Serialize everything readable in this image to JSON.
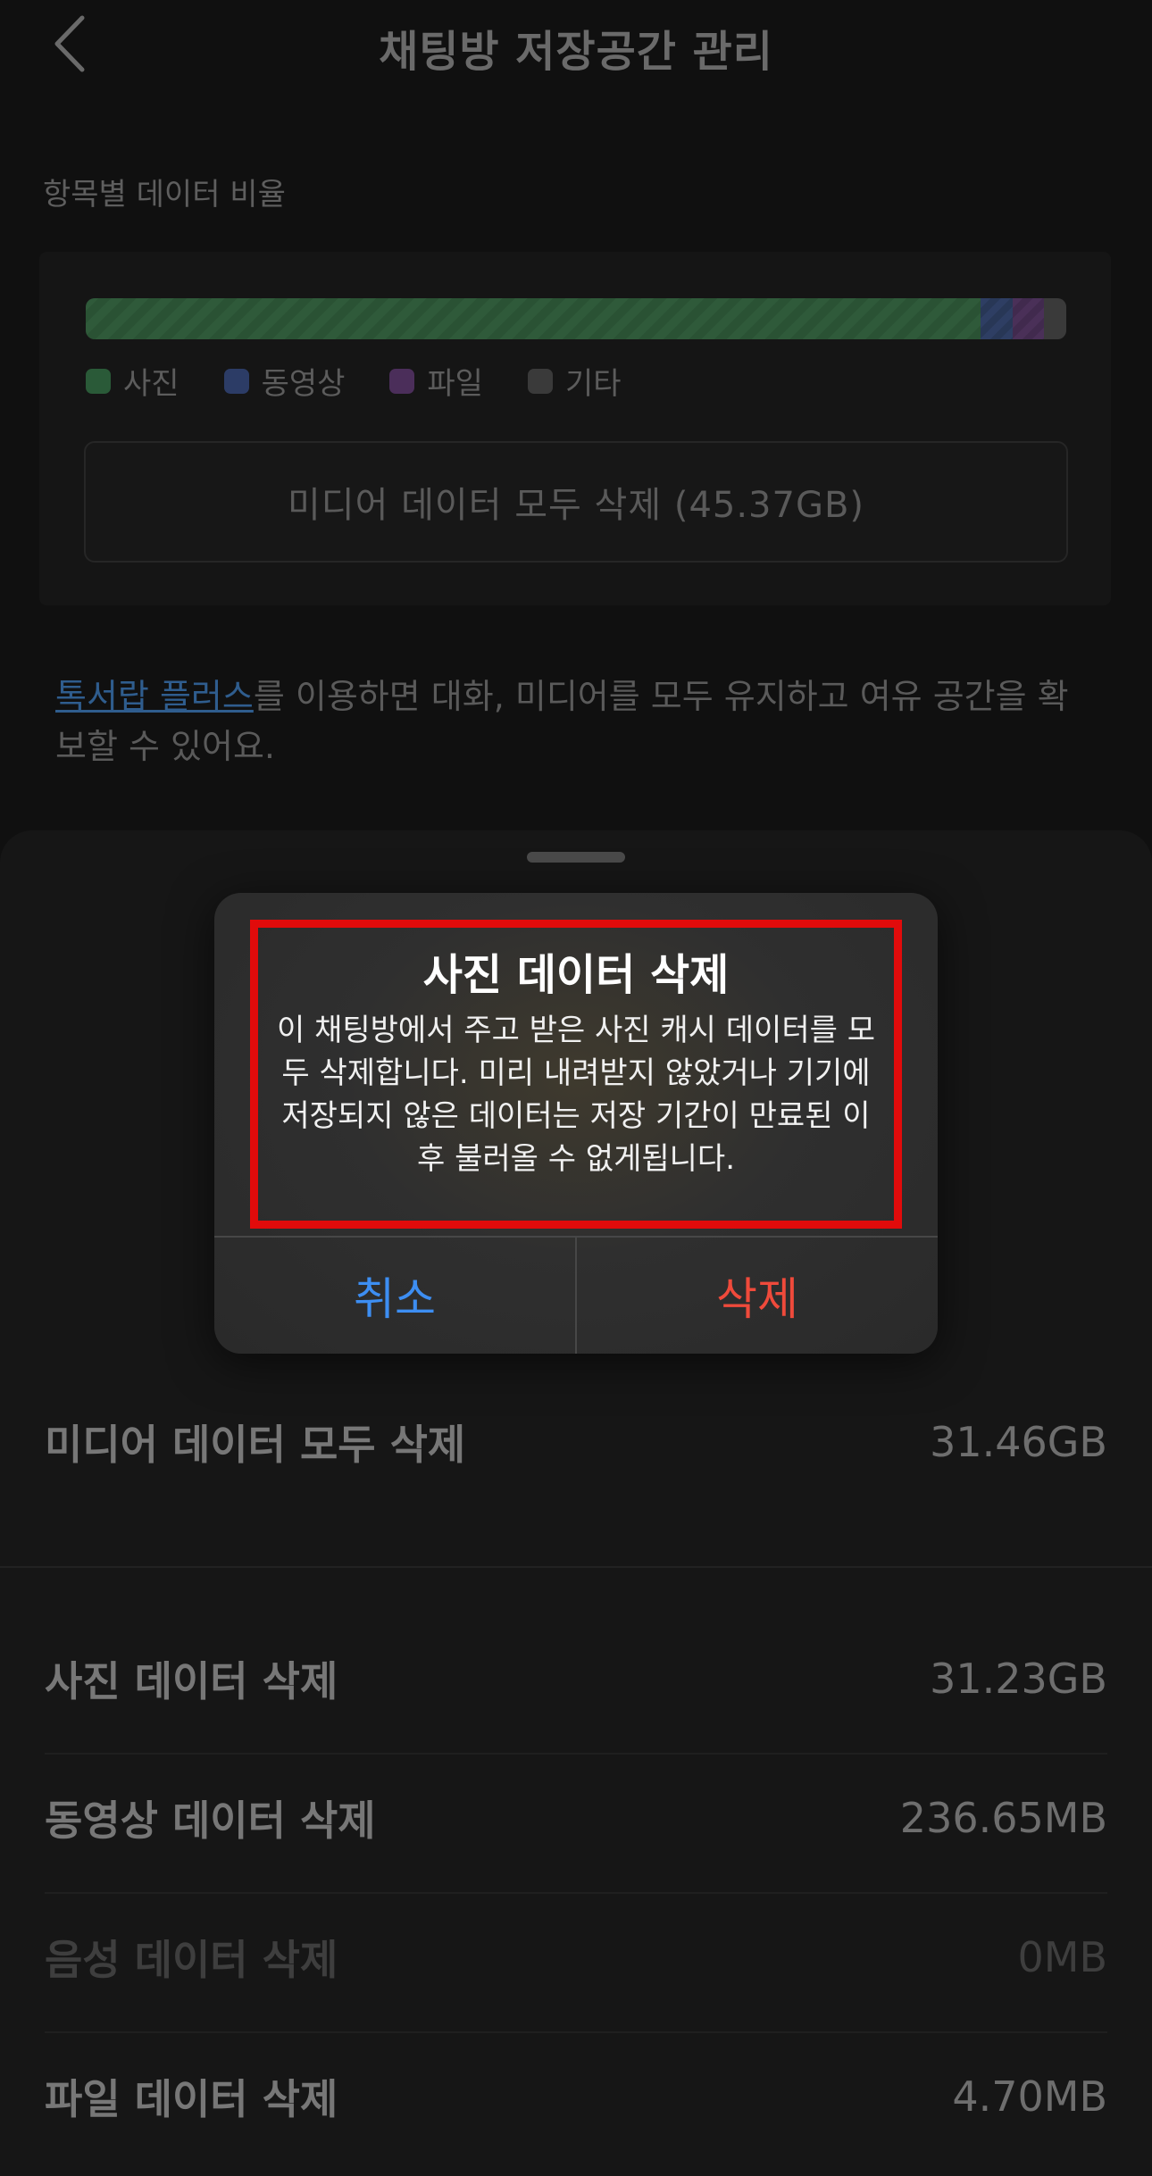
{
  "header": {
    "title": "채팅방 저장공간 관리"
  },
  "ratio": {
    "section_label": "항목별 데이터 비율",
    "segments": [
      {
        "key": "photo",
        "fraction": 0.913,
        "color": "#2f5a3a"
      },
      {
        "key": "video",
        "fraction": 0.032,
        "color": "#2e3e63"
      },
      {
        "key": "file",
        "fraction": 0.032,
        "color": "#4a3058"
      },
      {
        "key": "etc",
        "fraction": 0.023,
        "color": "#3a3a3a"
      }
    ],
    "legend": [
      {
        "label": "사진",
        "color": "#2a5a38"
      },
      {
        "label": "동영상",
        "color": "#2c3c66"
      },
      {
        "label": "파일",
        "color": "#4b2e5a"
      },
      {
        "label": "기타",
        "color": "#3a3a3a"
      }
    ],
    "media_delete_button": "미디어 데이터 모두 삭제 (45.37GB)"
  },
  "plus_note": {
    "link": "톡서랍 플러스",
    "text": "를 이용하면 대화, 미디어를 모두 유지하고 여유 공간을 확보할 수 있어요."
  },
  "sheet": {
    "all_media": {
      "label": "미디어 데이터 모두 삭제",
      "value": "31.46GB"
    },
    "rows": [
      {
        "label": "사진 데이터 삭제",
        "value": "31.23GB"
      },
      {
        "label": "동영상 데이터 삭제",
        "value": "236.65MB"
      },
      {
        "label": "음성 데이터 삭제",
        "value": "0MB"
      },
      {
        "label": "파일 데이터 삭제",
        "value": "4.70MB"
      }
    ]
  },
  "dialog": {
    "title": "사진 데이터 삭제",
    "body": "이 채팅방에서 주고 받은 사진 캐시 데이터를 모두 삭제합니다. 미리 내려받지 않았거나 기기에 저장되지 않은 데이터는 저장 기간이 만료된 이후 불러올 수 없게됩니다.",
    "cancel_label": "취소",
    "delete_label": "삭제"
  },
  "colors": {
    "highlight": "#e10b0b",
    "cancel": "#3d8ef2",
    "delete": "#ef4a3b",
    "link": "#2f5d8e"
  }
}
